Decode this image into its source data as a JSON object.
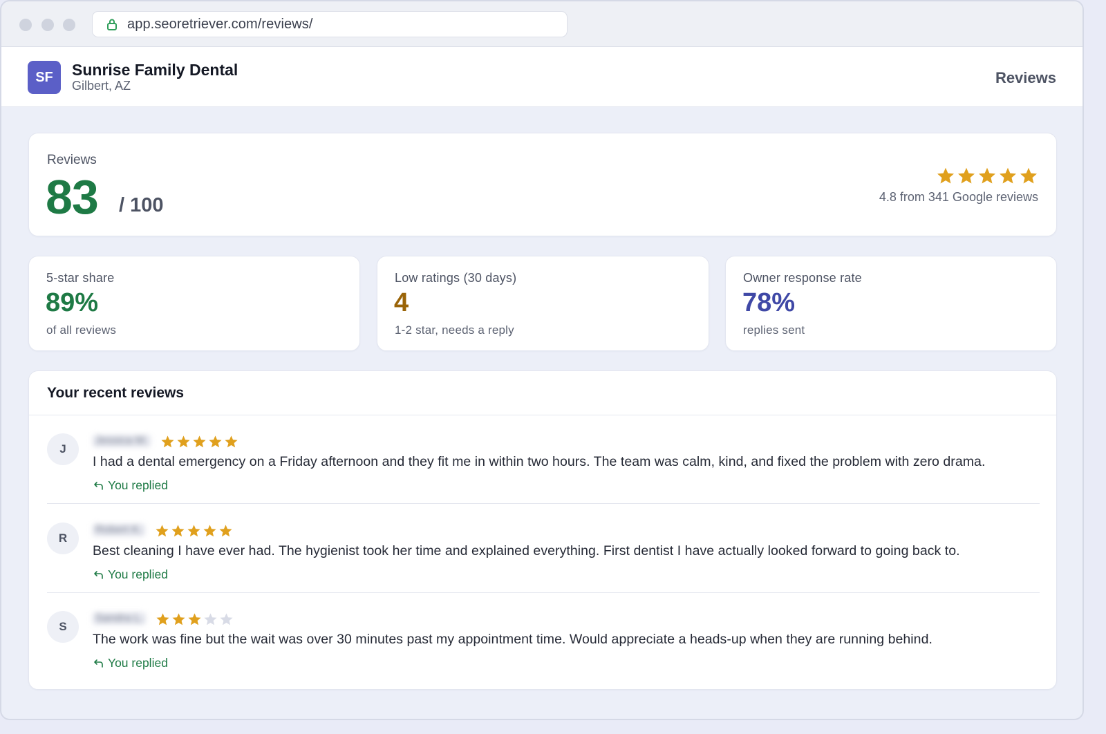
{
  "browser": {
    "url": "app.seoretriever.com/reviews/"
  },
  "header": {
    "logo_initials": "SF",
    "business_name": "Sunrise Family Dental",
    "location": "Gilbert, AZ",
    "nav_reviews": "Reviews"
  },
  "score": {
    "label": "Reviews",
    "value": "83",
    "out_of": "/ 100",
    "star_count": 5,
    "rating_summary": "4.8 from 341 Google reviews"
  },
  "stats": [
    {
      "label": "5-star share",
      "value": "89%",
      "sub": "of all reviews",
      "color": "#1e7a45"
    },
    {
      "label": "Low ratings (30 days)",
      "value": "4",
      "sub": "1-2 star, needs a reply",
      "color": "#9a6408"
    },
    {
      "label": "Owner response rate",
      "value": "78%",
      "sub": "replies sent",
      "color": "#3f48a6"
    }
  ],
  "reviews_section": {
    "title": "Your recent reviews",
    "items": [
      {
        "initial": "J",
        "name": "Jessica M.",
        "rating": 5,
        "text": "I had a dental emergency on a Friday afternoon and they fit me in within two hours. The team was calm, kind, and fixed the problem with zero drama.",
        "status": "You replied"
      },
      {
        "initial": "R",
        "name": "Robert K.",
        "rating": 5,
        "text": "Best cleaning I have ever had. The hygienist took her time and explained everything. First dentist I have actually looked forward to going back to.",
        "status": "You replied"
      },
      {
        "initial": "S",
        "name": "Sandra L.",
        "rating": 3,
        "text": "The work was fine but the wait was over 30 minutes past my appointment time. Would appreciate a heads-up when they are running behind.",
        "status": "You replied"
      }
    ]
  },
  "colors": {
    "star_filled": "#e0a01d",
    "star_empty": "#d8dbe6",
    "accent": "#5b5fc7"
  }
}
